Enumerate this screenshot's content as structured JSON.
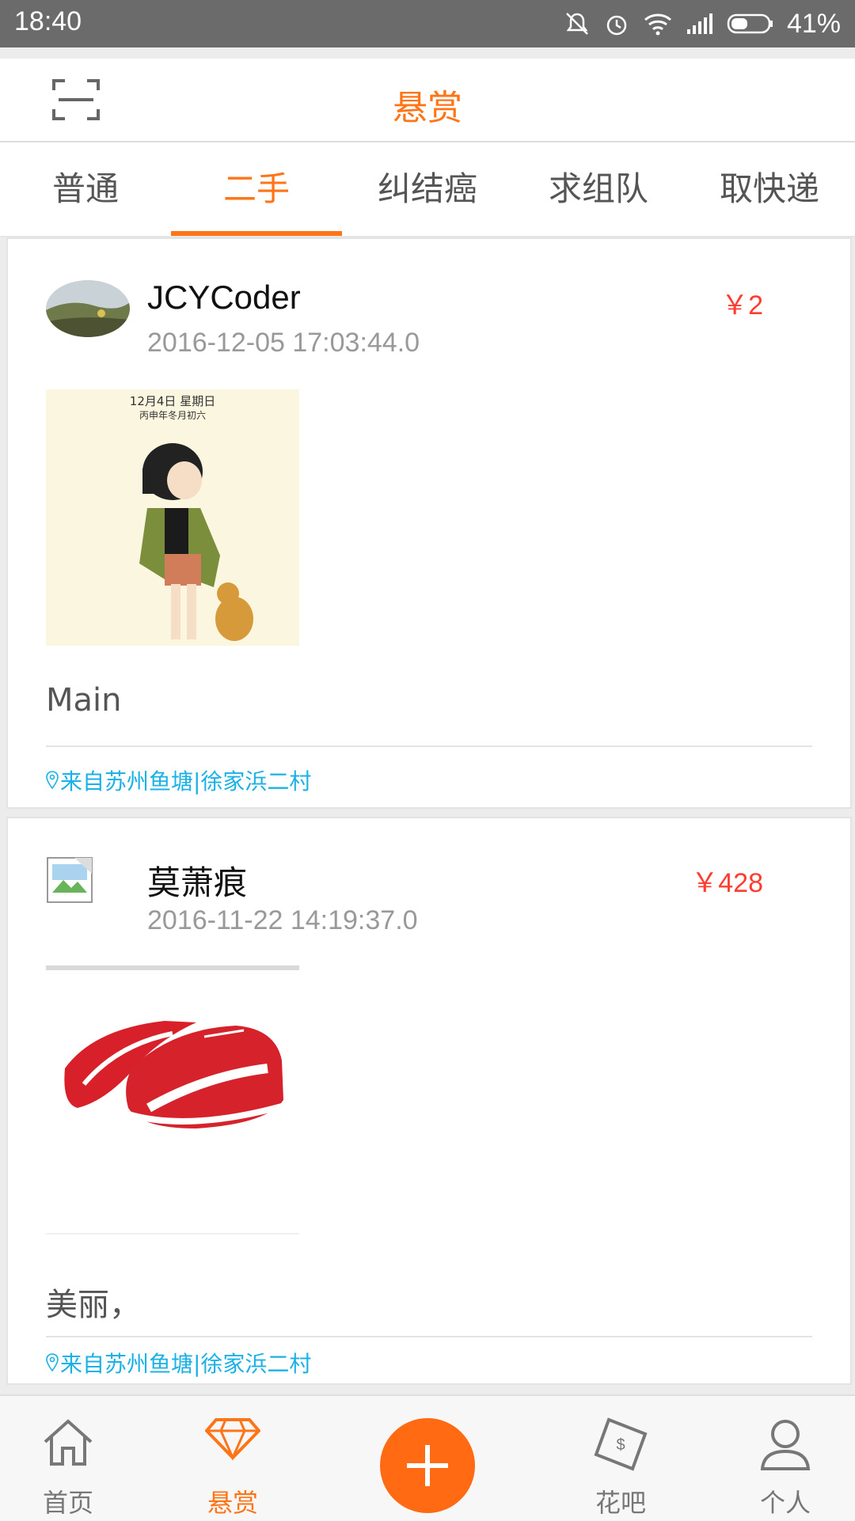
{
  "status": {
    "time": "18:40",
    "battery": "41%"
  },
  "header": {
    "title": "悬赏"
  },
  "tabs": [
    {
      "label": "普通"
    },
    {
      "label": "二手"
    },
    {
      "label": "纠结癌"
    },
    {
      "label": "求组队"
    },
    {
      "label": "取快递"
    }
  ],
  "posts": [
    {
      "author": "JCYCoder",
      "date": "2016-12-05 17:03:44.0",
      "price": "￥2",
      "image_text_line1": "12月4日 星期日",
      "image_text_line2": "丙申年冬月初六",
      "description": "Main",
      "location": "来自苏州鱼塘|徐家浜二村"
    },
    {
      "author": "莫萧痕",
      "date": "2016-11-22 14:19:37.0",
      "price": "￥428",
      "description": "美丽，",
      "location": "来自苏州鱼塘|徐家浜二村"
    }
  ],
  "nav": [
    {
      "label": "首页",
      "icon": "home-icon"
    },
    {
      "label": "悬赏",
      "icon": "diamond-icon"
    },
    {
      "label": "",
      "icon": "plus-icon"
    },
    {
      "label": "花吧",
      "icon": "money-icon"
    },
    {
      "label": "个人",
      "icon": "person-icon"
    }
  ],
  "colors": {
    "accent": "#ff7417",
    "price": "#ff3c2f",
    "location": "#1bb0e6"
  }
}
